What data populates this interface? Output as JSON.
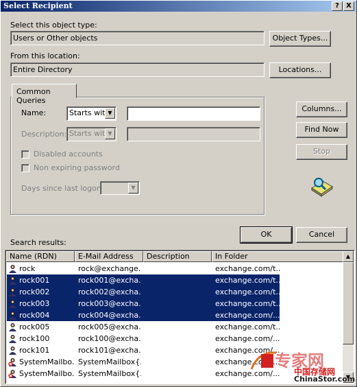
{
  "window": {
    "title": "Select Recipient",
    "help_label": "?",
    "close_label": "X"
  },
  "object_type": {
    "label": "Select this object type:",
    "value": "Users or Other objects",
    "button": "Object Types..."
  },
  "location": {
    "label": "From this location:",
    "value": "Entire Directory",
    "button": "Locations..."
  },
  "queries": {
    "tab": "Common Queries",
    "name_label": "Name:",
    "name_mode": "Starts with",
    "name_value": "",
    "description_label": "Description:",
    "description_mode": "Starts with",
    "disabled_accounts": "Disabled accounts",
    "non_expiring": "Non expiring password",
    "days_label": "Days since last logon:"
  },
  "side_buttons": {
    "columns": "Columns...",
    "find_now": "Find Now",
    "stop": "Stop"
  },
  "dialog_buttons": {
    "ok": "OK",
    "cancel": "Cancel"
  },
  "results": {
    "label": "Search results:",
    "columns": [
      "Name (RDN)",
      "E-Mail Address",
      "Description",
      "In Folder"
    ],
    "rows": [
      {
        "name": "rock",
        "email": "rock@exchange...",
        "description": "",
        "folder": "exchange.com/t...",
        "selected": false,
        "icon": "user-icon"
      },
      {
        "name": "rock001",
        "email": "rock001@excha...",
        "description": "",
        "folder": "exchange.com/t...",
        "selected": true,
        "icon": "user-icon"
      },
      {
        "name": "rock002",
        "email": "rock002@excha...",
        "description": "",
        "folder": "exchange.com/t...",
        "selected": true,
        "icon": "user-icon"
      },
      {
        "name": "rock003",
        "email": "rock003@excha...",
        "description": "",
        "folder": "exchange.com/t...",
        "selected": true,
        "icon": "user-icon"
      },
      {
        "name": "rock004",
        "email": "rock004@excha...",
        "description": "",
        "folder": "exchange.com/...",
        "selected": true,
        "icon": "user-icon"
      },
      {
        "name": "rock005",
        "email": "rock005@excha...",
        "description": "",
        "folder": "exchange.com/t...",
        "selected": false,
        "icon": "user-icon"
      },
      {
        "name": "rock100",
        "email": "rock100@excha...",
        "description": "",
        "folder": "exchange.com/...",
        "selected": false,
        "icon": "user-icon"
      },
      {
        "name": "rock101",
        "email": "rock101@excha...",
        "description": "",
        "folder": "exchange.com/...",
        "selected": false,
        "icon": "user-icon"
      },
      {
        "name": "SystemMailbo...",
        "email": "SystemMailbox{...",
        "description": "",
        "folder": "exchange.com/...",
        "selected": false,
        "icon": "disabled-user-icon"
      },
      {
        "name": "SystemMailbo...",
        "email": "SystemMailbox{...",
        "description": "",
        "folder": "exchange.com/...",
        "selected": false,
        "icon": "disabled-user-icon"
      }
    ]
  },
  "watermark": {
    "brand_cn": "专家网",
    "site_cn": "中国存储网",
    "site_url": "ChinaStor.com"
  },
  "colors": {
    "title_start": "#0a246a",
    "title_end": "#a6caf0",
    "selection": "#0a246a",
    "dialog_bg": "#d4d0c8"
  }
}
